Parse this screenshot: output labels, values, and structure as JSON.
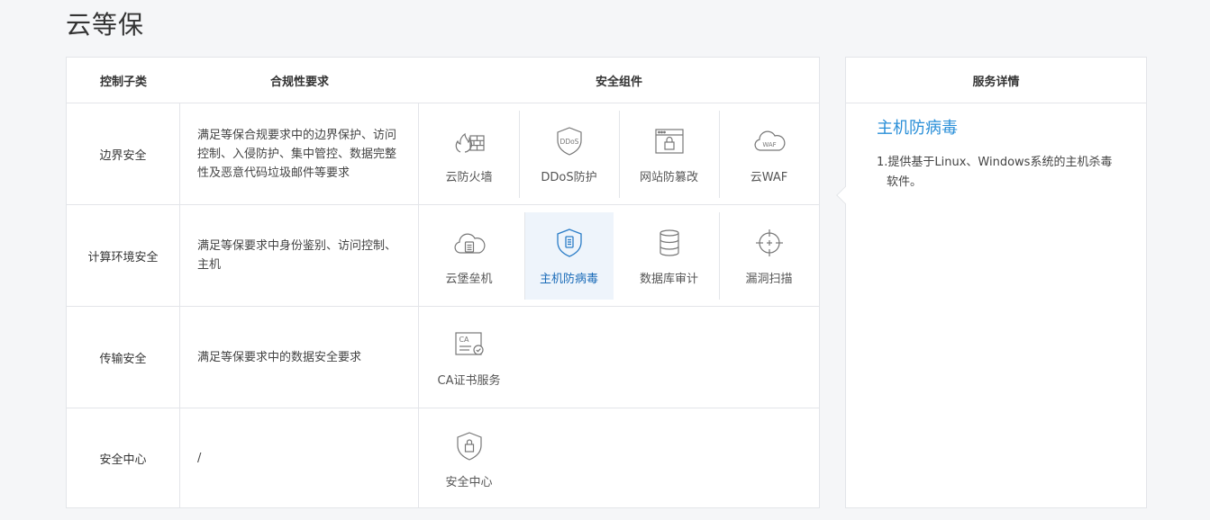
{
  "page": {
    "title": "云等保"
  },
  "matrix": {
    "headers": {
      "sub": "控制子类",
      "req": "合规性要求",
      "comp": "安全组件"
    },
    "rows": [
      {
        "sub": "边界安全",
        "req": "满足等保合规要求中的边界保护、访问控制、入侵防护、集中管控、数据完整性及恶意代码垃圾邮件等要求",
        "components": [
          {
            "label": "云防火墙",
            "icon": "firewall-icon"
          },
          {
            "label": "DDoS防护",
            "icon": "ddos-shield-icon"
          },
          {
            "label": "网站防篡改",
            "icon": "web-lock-icon"
          },
          {
            "label": "云WAF",
            "icon": "cloud-waf-icon"
          }
        ]
      },
      {
        "sub": "计算环境安全",
        "req": "满足等保要求中身份鉴别、访问控制、主机",
        "components": [
          {
            "label": "云堡垒机",
            "icon": "cloud-server-icon"
          },
          {
            "label": "主机防病毒",
            "icon": "shield-server-icon"
          },
          {
            "label": "数据库审计",
            "icon": "database-icon"
          },
          {
            "label": "漏洞扫描",
            "icon": "crosshair-icon"
          }
        ]
      },
      {
        "sub": "传输安全",
        "req": "满足等保要求中的数据安全要求",
        "components": [
          {
            "label": "CA证书服务",
            "icon": "certificate-icon"
          }
        ]
      },
      {
        "sub": "安全中心",
        "req": "/",
        "components": [
          {
            "label": "安全中心",
            "icon": "shield-lock-icon"
          }
        ]
      }
    ]
  },
  "detail": {
    "header": "服务详情",
    "title": "主机防病毒",
    "description": "1.提供基于Linux、Windows系统的主机杀毒软件。"
  },
  "colors": {
    "accent": "#2a8fd8",
    "active_bg": "#eef4fb",
    "border": "#e3e5e9"
  },
  "icon_text": {
    "ddos": "DDoS",
    "waf": "WAF",
    "ca": "CA"
  }
}
